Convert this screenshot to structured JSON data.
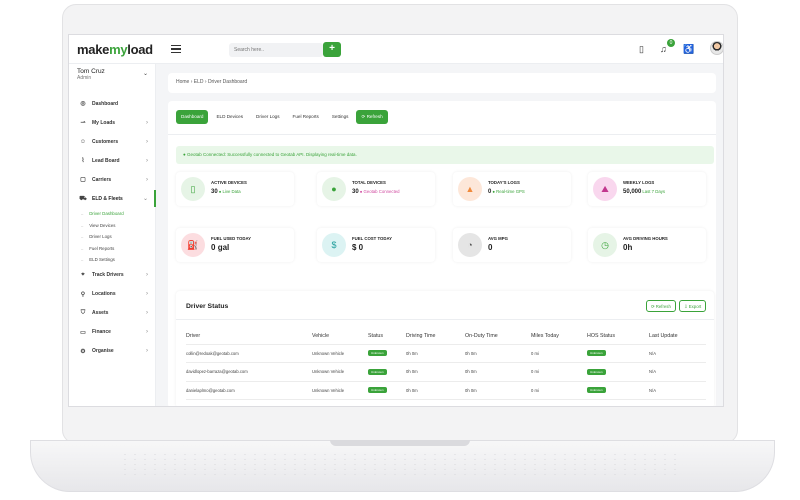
{
  "app": {
    "logo_text_a": "make",
    "logo_text_b": "my",
    "logo_text_c": "load",
    "search_placeholder": "Search here..",
    "add_label": "+",
    "notification_count": "0"
  },
  "user": {
    "name": "Tom Cruz",
    "role": "Admin"
  },
  "sidebar": {
    "items": [
      {
        "label": "Dashboard",
        "icon": "dashboard-icon",
        "glyph": "◎",
        "arrow": ""
      },
      {
        "label": "My Loads",
        "icon": "loads-icon",
        "glyph": "⇀",
        "arrow": "›"
      },
      {
        "label": "Customers",
        "icon": "customers-icon",
        "glyph": "☺",
        "arrow": "›"
      },
      {
        "label": "Lead Board",
        "icon": "chart-icon",
        "glyph": "⌇",
        "arrow": "›"
      },
      {
        "label": "Carriers",
        "icon": "carriers-icon",
        "glyph": "▢",
        "arrow": "›"
      },
      {
        "label": "ELD & Fleets",
        "icon": "truck-icon",
        "glyph": "⛟",
        "arrow": "⌄"
      }
    ],
    "sub_items": [
      {
        "label": "Driver Dashboard"
      },
      {
        "label": "View Devices"
      },
      {
        "label": "Driver Logs"
      },
      {
        "label": "Fuel Reports"
      },
      {
        "label": "ELD Settings"
      }
    ],
    "items_after": [
      {
        "label": "Track Drivers",
        "icon": "location-icon",
        "glyph": "⌖",
        "arrow": "›"
      },
      {
        "label": "Locations",
        "icon": "pin-icon",
        "glyph": "⚲",
        "arrow": "›"
      },
      {
        "label": "Assets",
        "icon": "assets-icon",
        "glyph": "⛉",
        "arrow": "›"
      },
      {
        "label": "Finance",
        "icon": "finance-icon",
        "glyph": "▭",
        "arrow": "›"
      },
      {
        "label": "Organise",
        "icon": "gear-icon",
        "glyph": "⚙",
        "arrow": "›"
      }
    ]
  },
  "breadcrumb": "Home › ELD › Driver Dashboard",
  "tabs": [
    {
      "label": "Dashboard",
      "active": true
    },
    {
      "label": "ELD Devices"
    },
    {
      "label": "Driver Logs"
    },
    {
      "label": "Fuel Reports"
    },
    {
      "label": "Settings"
    },
    {
      "label": "⟳ Refresh",
      "refresh": true
    }
  ],
  "alert": "● Geotab Connected: Successfully connected to Geotab API. Displaying real-time data.",
  "stats": [
    {
      "label": "ACTIVE DEVICES",
      "value": "30",
      "sub": "● Live Data",
      "glyph": "▯",
      "bg": "#e6f4e6",
      "fg": "#3aa33a"
    },
    {
      "label": "TOTAL DEVICES",
      "value": "30",
      "sub": "● Geotab Connected",
      "sub_class": "pink",
      "glyph": "●",
      "bg": "#e6f4e6",
      "fg": "#3aa33a"
    },
    {
      "label": "TODAY'S LOGS",
      "value": "0",
      "sub": "● Real-time GPS",
      "glyph": "▲",
      "bg": "#fde7d9",
      "fg": "#f08a3c"
    },
    {
      "label": "WEEKLY LOGS",
      "value": "50,000",
      "sub": "Last 7 Days",
      "glyph": "⛰",
      "bg": "#f9d7ee",
      "fg": "#c2378e"
    },
    {
      "label": "FUEL USED TODAY",
      "value": "0",
      "unit": "gal",
      "glyph": "⛽",
      "bg": "#fcdde0",
      "fg": "#e0455a"
    },
    {
      "label": "FUEL COST TODAY",
      "value": "$ 0",
      "glyph": "$",
      "bg": "#dcf3f3",
      "fg": "#1e9c9a"
    },
    {
      "label": "AVG MPG",
      "value": "0",
      "glyph": "◔",
      "bg": "#e5e5e5",
      "fg": "#555555"
    },
    {
      "label": "AVG DRIVING HOURS",
      "value": "0h",
      "glyph": "◷",
      "bg": "#e6f4e6",
      "fg": "#3aa33a"
    }
  ],
  "driver_status": {
    "title": "Driver Status",
    "refresh_label": "⟳ Refresh",
    "export_label": "⇩ Export",
    "columns": [
      "Driver",
      "Vehicle",
      "Status",
      "Driving Time",
      "On-Duty Time",
      "Miles Today",
      "HOS Status",
      "Last Update"
    ],
    "rows": [
      [
        "collin@redoak@geotab.com",
        "Unknown Vehicle",
        "Unknown",
        "0h 0m",
        "0h 0m",
        "0 mi",
        "Unknown",
        "N/A"
      ],
      [
        "davidlopez-barraza@geotab.com",
        "Unknown Vehicle",
        "Unknown",
        "0h 0m",
        "0h 0m",
        "0 mi",
        "Unknown",
        "N/A"
      ],
      [
        "danielaplmo@geotab.com",
        "Unknown Vehicle",
        "Unknown",
        "0h 0m",
        "0h 0m",
        "0 mi",
        "Unknown",
        "N/A"
      ]
    ]
  },
  "colors": {
    "accent": "#3aa33a"
  }
}
